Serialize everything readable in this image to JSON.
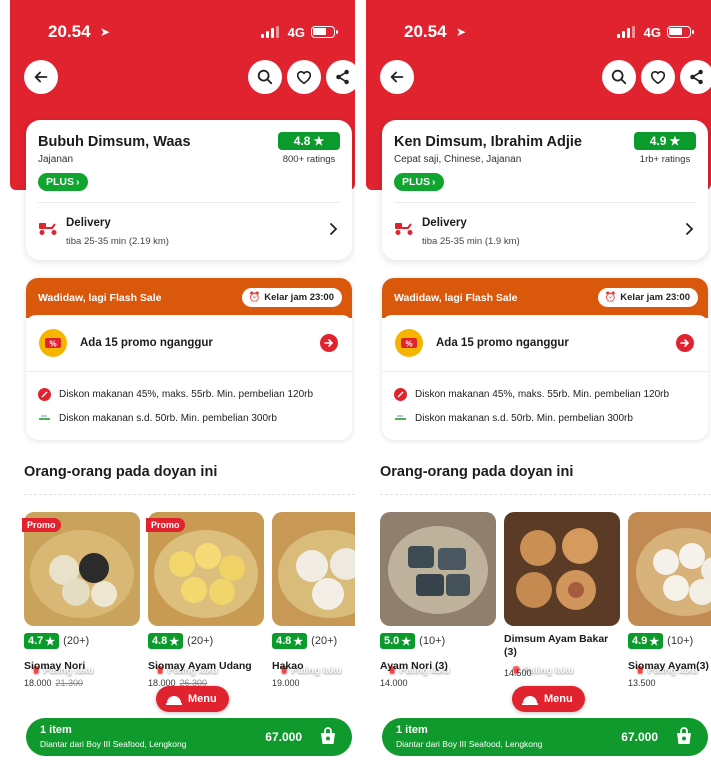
{
  "colors": {
    "brand_red": "#e1222f",
    "green": "#0b9a2c",
    "flash_orange": "#d9580c"
  },
  "screens": [
    {
      "status": {
        "time": "20.54",
        "network": "4G"
      },
      "restaurant": {
        "name": "Bubuh Dimsum, Waas",
        "categories": "Jajanan",
        "plus": "PLUS",
        "rating": "4.8",
        "rating_count": "800+ ratings"
      },
      "delivery": {
        "title": "Delivery",
        "eta": "tiba 25-35 min (2.19 km)"
      },
      "flash": {
        "label": "Wadidaw, lagi Flash Sale",
        "ends": "Kelar jam 23:00"
      },
      "promo": {
        "headline": "Ada 15 promo nganggur",
        "line1": "Diskon makanan 45%, maks. 55rb. Min. pembelian 120rb",
        "line2": "Diskon makanan s.d. 50rb. Min. pembelian 300rb"
      },
      "section_title": "Orang-orang pada doyan ini",
      "foods": [
        {
          "name": "Siomay Nori",
          "rating": "4.7",
          "count": "(20+)",
          "price": "18.000",
          "old_price": "21.300",
          "tag": "Promo",
          "best": "Paling laku"
        },
        {
          "name": "Siomay Ayam Udang",
          "rating": "4.8",
          "count": "(20+)",
          "price": "18.000",
          "old_price": "26.300",
          "tag": "Promo",
          "best": "Paling laku"
        },
        {
          "name": "Hakao",
          "rating": "4.8",
          "count": "(20+)",
          "price": "19.000",
          "best": "Paling laku"
        }
      ],
      "menu_button": "Menu",
      "cart": {
        "items": "1 item",
        "from": "Diantar dari Boy III Seafood, Lengkong",
        "total": "67.000"
      }
    },
    {
      "status": {
        "time": "20.54",
        "network": "4G"
      },
      "restaurant": {
        "name": "Ken Dimsum, Ibrahim Adjie",
        "categories": "Cepat saji, Chinese, Jajanan",
        "plus": "PLUS",
        "rating": "4.9",
        "rating_count": "1rb+ ratings"
      },
      "delivery": {
        "title": "Delivery",
        "eta": "tiba 25-35 min (1.9 km)"
      },
      "flash": {
        "label": "Wadidaw, lagi Flash Sale",
        "ends": "Kelar jam 23:00"
      },
      "promo": {
        "headline": "Ada 15 promo nganggur",
        "line1": "Diskon makanan 45%, maks. 55rb. Min. pembelian 120rb",
        "line2": "Diskon makanan s.d. 50rb. Min. pembelian 300rb"
      },
      "section_title": "Orang-orang pada doyan ini",
      "foods": [
        {
          "name": "Ayam Nori (3)",
          "rating": "5.0",
          "count": "(10+)",
          "price": "14.000",
          "best": "Paling laku"
        },
        {
          "name": "Dimsum Ayam Bakar (3)",
          "price": "14.500",
          "best": "Paling laku"
        },
        {
          "name": "Siomay Ayam(3)",
          "rating": "4.9",
          "count": "(10+)",
          "price": "13.500",
          "best": "Paling laku"
        }
      ],
      "menu_button": "Menu",
      "cart": {
        "items": "1 item",
        "from": "Diantar dari Boy III Seafood, Lengkong",
        "total": "67.000"
      }
    }
  ]
}
